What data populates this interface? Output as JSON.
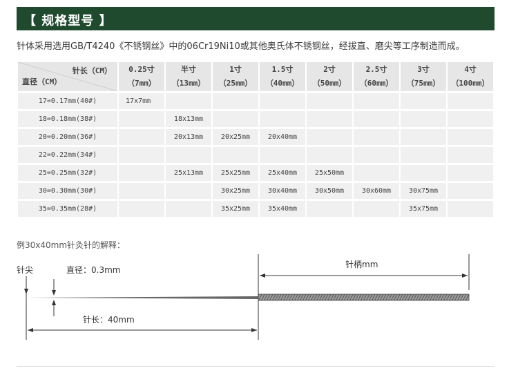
{
  "banner": {
    "title": "【 规格型号 】"
  },
  "intro": "针体采用选用GB/T4240《不锈钢丝》中的06Cr19Ni10或其他奥氏体不锈钢丝，经拔直、磨尖等工序制造而成。",
  "table": {
    "corner_top": "针长（CM）",
    "corner_bottom": "直径（CM）",
    "columns": [
      {
        "top": "0.25寸",
        "bottom": "（7mm）"
      },
      {
        "top": "半寸",
        "bottom": "（13mm）"
      },
      {
        "top": "1寸",
        "bottom": "（25mm）"
      },
      {
        "top": "1.5寸",
        "bottom": "（40mm）"
      },
      {
        "top": "2寸",
        "bottom": "（50mm）"
      },
      {
        "top": "2.5寸",
        "bottom": "（60mm）"
      },
      {
        "top": "3寸",
        "bottom": "（75mm）"
      },
      {
        "top": "4寸",
        "bottom": "（100mm）"
      }
    ],
    "rows": [
      {
        "label": "17=0.17mm(40#)",
        "cells": [
          "17x7mm",
          "",
          "",
          "",
          "",
          "",
          "",
          ""
        ]
      },
      {
        "label": "18=0.18mm(38#)",
        "cells": [
          "",
          "18x13mm",
          "",
          "",
          "",
          "",
          "",
          ""
        ]
      },
      {
        "label": "20=0.20mm(36#)",
        "cells": [
          "",
          "20x13mm",
          "20x25mm",
          "20x40mm",
          "",
          "",
          "",
          ""
        ]
      },
      {
        "label": "22=0.22mm(34#)",
        "cells": [
          "",
          "",
          "",
          "",
          "",
          "",
          "",
          ""
        ]
      },
      {
        "label": "25=0.25mm(32#)",
        "cells": [
          "",
          "25x13mm",
          "25x25mm",
          "25x40mm",
          "25x50mm",
          "",
          "",
          ""
        ]
      },
      {
        "label": "30=0.30mm(30#)",
        "cells": [
          "",
          "",
          "30x25mm",
          "30x40mm",
          "30x50mm",
          "30x60mm",
          "30x75mm",
          ""
        ]
      },
      {
        "label": "35=0.35mm(28#)",
        "cells": [
          "",
          "",
          "35x25mm",
          "35x40mm",
          "",
          "",
          "35x75mm",
          ""
        ]
      }
    ]
  },
  "example_title": "例30x40mm针灸针的解释：",
  "diagram": {
    "tip_label": "针尖",
    "diameter_label": "直径：0.3mm",
    "handle_label": "针柄mm",
    "length_label": "针长：40mm"
  },
  "colors": {
    "banner": "#1f4a2e",
    "cell": "#f0f0f0",
    "header": "#e6e6e6"
  }
}
